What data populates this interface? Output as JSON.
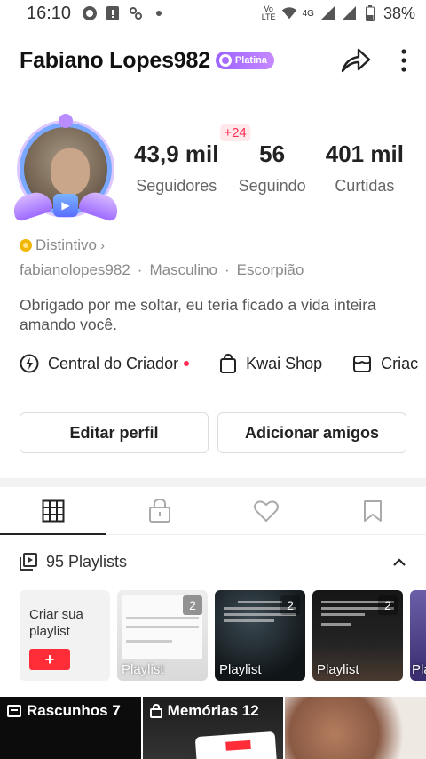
{
  "statusbar": {
    "time": "16:10",
    "network": "4G",
    "volte": "Vo LTE",
    "battery": "38%"
  },
  "header": {
    "username": "Fabiano Lopes982",
    "tier_badge": "Platina"
  },
  "stats": {
    "new_followers": "+24",
    "followers_value": "43,9 mil",
    "followers_label": "Seguidores",
    "following_value": "56",
    "following_label": "Seguindo",
    "likes_value": "401 mil",
    "likes_label": "Curtidas"
  },
  "profile": {
    "badge_link": "Distintivo",
    "handle": "fabianolopes982",
    "gender": "Masculino",
    "zodiac": "Escorpião",
    "separator": "·",
    "bio": "Obrigado por me soltar, eu teria ficado a vida inteira amando você."
  },
  "shortcuts": {
    "creator_center": "Central do Criador",
    "shop": "Kwai Shop",
    "third": "Criac"
  },
  "buttons": {
    "edit_profile": "Editar perfil",
    "add_friends": "Adicionar amigos"
  },
  "playlists": {
    "header": "95 Playlists",
    "create_label": "Criar sua playlist",
    "items": [
      {
        "label": "Playlist",
        "count": "2"
      },
      {
        "label": "Playlist",
        "count": "2"
      },
      {
        "label": "Playlist",
        "count": "2"
      },
      {
        "label": "Pla",
        "count": ""
      }
    ]
  },
  "tiles": {
    "drafts": "Rascunhos 7",
    "memories": "Memórias 12"
  },
  "colors": {
    "accent_red": "#ff2d38",
    "badge_purple": "#a66bff",
    "coin": "#f2b705"
  }
}
